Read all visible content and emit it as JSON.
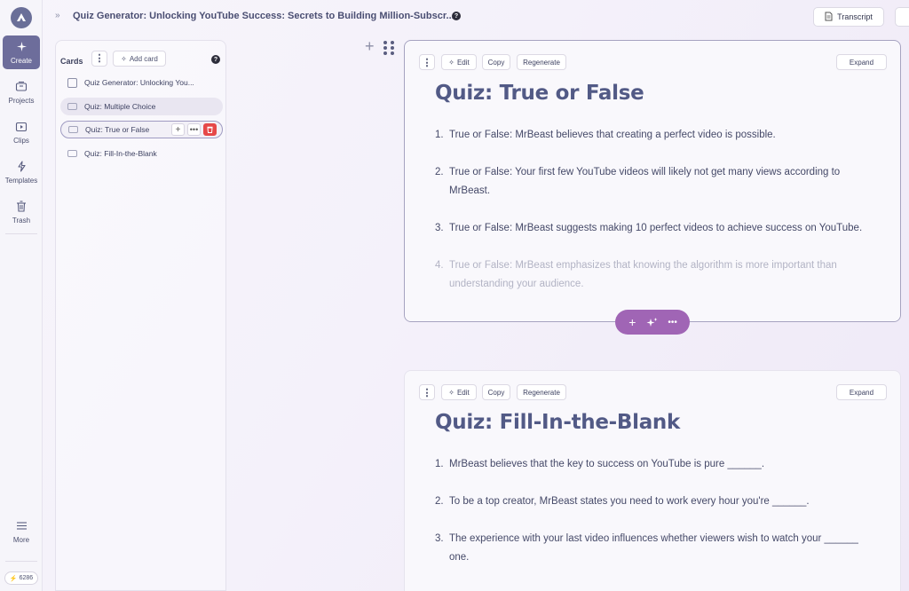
{
  "rail": {
    "items": [
      {
        "label": "Create",
        "icon": "sparkle-icon"
      },
      {
        "label": "Projects",
        "icon": "projects-icon"
      },
      {
        "label": "Clips",
        "icon": "clips-icon"
      },
      {
        "label": "Templates",
        "icon": "templates-icon"
      },
      {
        "label": "Trash",
        "icon": "trash-icon"
      }
    ],
    "more_label": "More",
    "credits": "6286"
  },
  "header": {
    "title": "Quiz Generator: Unlocking YouTube Success: Secrets to Building Million-Subscr...",
    "help": "?",
    "transcript_label": "Transcript"
  },
  "cards_panel": {
    "label": "Cards",
    "add_card_label": "Add card",
    "help": "?",
    "items": [
      {
        "label": "Quiz Generator: Unlocking You..."
      },
      {
        "label": "Quiz: Multiple Choice"
      },
      {
        "label": "Quiz: True or False"
      },
      {
        "label": "Quiz: Fill-In-the-Blank"
      }
    ]
  },
  "toolbar": {
    "edit_label": "Edit",
    "copy_label": "Copy",
    "regenerate_label": "Regenerate",
    "expand_label": "Expand"
  },
  "card1": {
    "title": "Quiz: True or False",
    "questions": [
      {
        "num": "1.",
        "text": "True or False: MrBeast believes that creating a perfect video is possible."
      },
      {
        "num": "2.",
        "text": "True or False: Your first few YouTube videos will likely not get many views according to MrBeast."
      },
      {
        "num": "3.",
        "text": "True or False: MrBeast suggests making 10 perfect videos to achieve success on YouTube."
      },
      {
        "num": "4.",
        "text": "True or False: MrBeast emphasizes that knowing the algorithm is more important than understanding your audience."
      }
    ]
  },
  "card2": {
    "title": "Quiz: Fill-In-the-Blank",
    "questions": [
      {
        "num": "1.",
        "text": "MrBeast believes that the key to success on YouTube is pure ______."
      },
      {
        "num": "2.",
        "text": "To be a top creator, MrBeast states you need to work every hour you're ______."
      },
      {
        "num": "3.",
        "text": "The experience with your last video influences whether viewers wish to watch your ______ one."
      }
    ]
  },
  "colors": {
    "accent": "#6d6d9b",
    "floating_bar": "#a065b5",
    "delete": "#e64848",
    "title": "#525a86"
  }
}
